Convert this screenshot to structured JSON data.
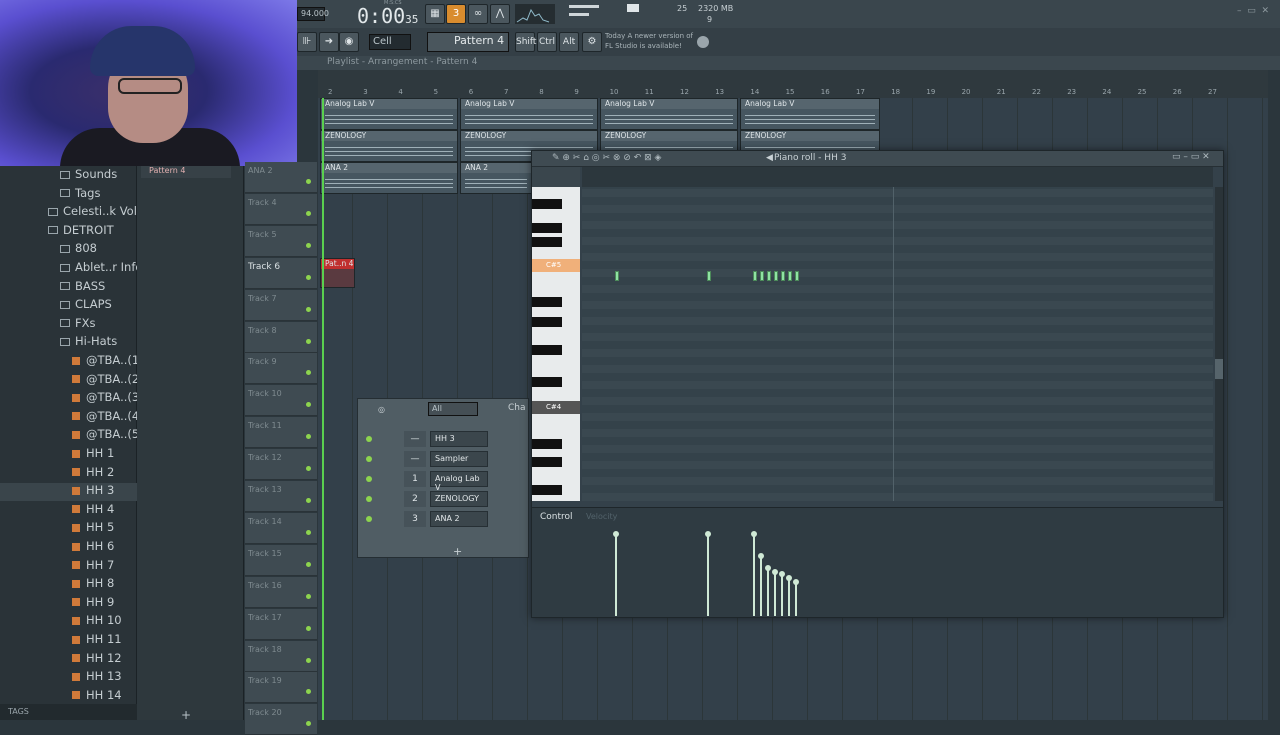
{
  "toolbar": {
    "tempo": "94.000",
    "time_main": "0:00",
    "time_sub": "35",
    "time_ticks": "M:S:CS",
    "snap": "Cell",
    "pattern": "Pattern 4",
    "shift": "Shift",
    "ctrl": "Ctrl",
    "alt": "Alt",
    "news_date": "Today",
    "news_line1": "A newer version of",
    "news_line2": "FL Studio is available!",
    "cpu": "25",
    "mem": "2320 MB",
    "polyphony": "9"
  },
  "playlist": {
    "title": "Playlist - Arrangement - Pattern 4",
    "bar_numbers": [
      "2",
      "3",
      "4",
      "5",
      "6",
      "7",
      "8",
      "9",
      "10",
      "11",
      "12",
      "13",
      "14",
      "15",
      "16",
      "17",
      "18",
      "19",
      "20",
      "21",
      "22",
      "23",
      "24",
      "25",
      "26",
      "27"
    ],
    "tracks": [
      "ANA 2",
      "Track 4",
      "Track 5",
      "Track 6",
      "Track 7",
      "Track 8",
      "Track 9",
      "Track 10",
      "Track 11",
      "Track 12",
      "Track 13",
      "Track 14",
      "Track 15",
      "Track 16",
      "Track 17",
      "Track 18",
      "Track 19",
      "Track 20"
    ],
    "clip_analog": "Analog Lab V",
    "clip_zenology": "ZENOLOGY",
    "clip_ana2": "ANA 2",
    "clip_pattern": "Pat..n 4"
  },
  "browser": {
    "items": [
      {
        "label": "Sounds",
        "kind": "folder",
        "indent": 60
      },
      {
        "label": "Tags",
        "kind": "folder",
        "indent": 60
      },
      {
        "label": "Celesti..k Vol 1",
        "kind": "folder",
        "indent": 48
      },
      {
        "label": "DETROIT",
        "kind": "folder",
        "indent": 48
      },
      {
        "label": "808",
        "kind": "folder",
        "indent": 60
      },
      {
        "label": "Ablet..r Info",
        "kind": "folder",
        "indent": 60
      },
      {
        "label": "BASS",
        "kind": "folder",
        "indent": 60
      },
      {
        "label": "CLAPS",
        "kind": "folder",
        "indent": 60
      },
      {
        "label": "FXs",
        "kind": "folder",
        "indent": 60
      },
      {
        "label": "Hi-Hats",
        "kind": "folder",
        "indent": 60
      },
      {
        "label": "@TBA..(1)",
        "kind": "file",
        "indent": 72
      },
      {
        "label": "@TBA..(2)",
        "kind": "file",
        "indent": 72
      },
      {
        "label": "@TBA..(3)",
        "kind": "file",
        "indent": 72
      },
      {
        "label": "@TBA..(4)",
        "kind": "file",
        "indent": 72
      },
      {
        "label": "@TBA..(5)",
        "kind": "file",
        "indent": 72
      },
      {
        "label": "HH 1",
        "kind": "file",
        "indent": 72
      },
      {
        "label": "HH 2",
        "kind": "file",
        "indent": 72
      },
      {
        "label": "HH 3",
        "kind": "file",
        "indent": 72
      },
      {
        "label": "HH 4",
        "kind": "file",
        "indent": 72
      },
      {
        "label": "HH 5",
        "kind": "file",
        "indent": 72
      },
      {
        "label": "HH 6",
        "kind": "file",
        "indent": 72
      },
      {
        "label": "HH 7",
        "kind": "file",
        "indent": 72
      },
      {
        "label": "HH 8",
        "kind": "file",
        "indent": 72
      },
      {
        "label": "HH 9",
        "kind": "file",
        "indent": 72
      },
      {
        "label": "HH 10",
        "kind": "file",
        "indent": 72
      },
      {
        "label": "HH 11",
        "kind": "file",
        "indent": 72
      },
      {
        "label": "HH 12",
        "kind": "file",
        "indent": 72
      },
      {
        "label": "HH 13",
        "kind": "file",
        "indent": 72
      },
      {
        "label": "HH 14",
        "kind": "file",
        "indent": 72
      }
    ],
    "tags_label": "TAGS",
    "pattern_item": "Pattern 4"
  },
  "pianoroll": {
    "title": "Piano roll - HH 3",
    "key_label_1": "C#5",
    "key_label_2": "C#4",
    "control_label": "Control",
    "control_sub": "Velocity"
  },
  "channelrack": {
    "filter": "All",
    "title": "Cha",
    "add": "+",
    "channels": [
      {
        "num": "—",
        "name": "HH 3"
      },
      {
        "num": "—",
        "name": "Sampler"
      },
      {
        "num": "1",
        "name": "Analog Lab V"
      },
      {
        "num": "2",
        "name": "ZENOLOGY"
      },
      {
        "num": "3",
        "name": "ANA 2"
      }
    ]
  }
}
